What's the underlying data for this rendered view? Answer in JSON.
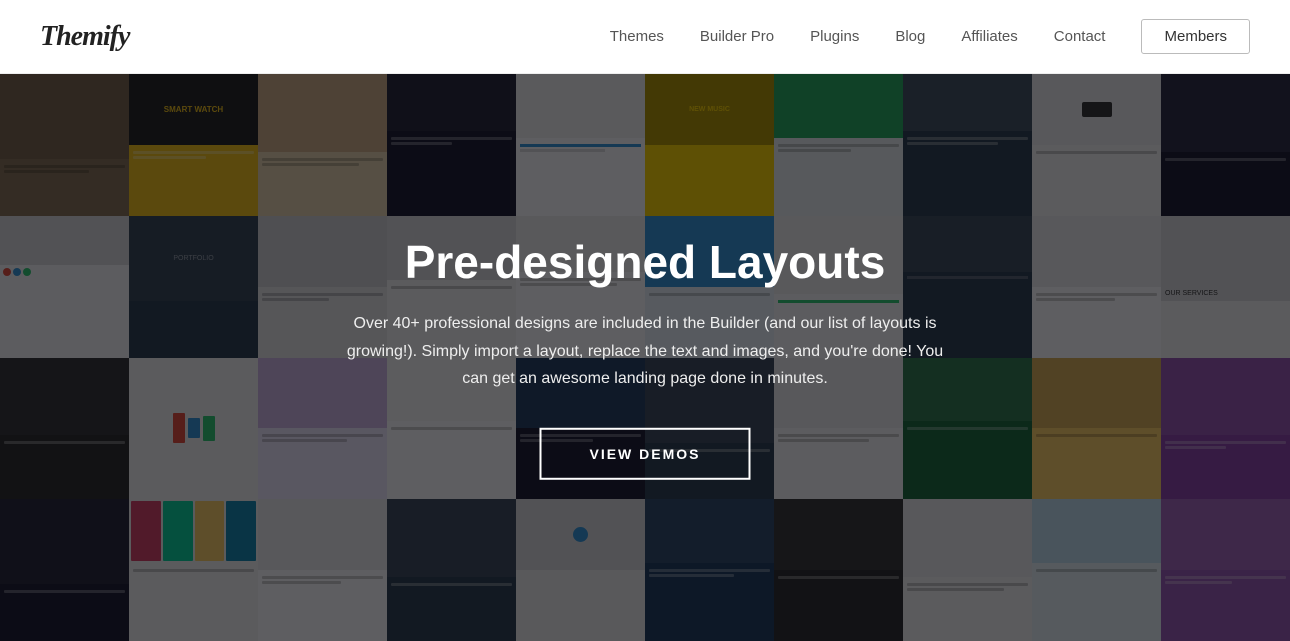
{
  "header": {
    "logo": "Themify",
    "nav": {
      "items": [
        {
          "label": "Themes",
          "id": "themes"
        },
        {
          "label": "Builder Pro",
          "id": "builder-pro"
        },
        {
          "label": "Plugins",
          "id": "plugins"
        },
        {
          "label": "Blog",
          "id": "blog"
        },
        {
          "label": "Affiliates",
          "id": "affiliates"
        },
        {
          "label": "Contact",
          "id": "contact"
        }
      ],
      "cta": "Members"
    }
  },
  "hero": {
    "title": "Pre-designed Layouts",
    "subtitle": "Over 40+ professional designs are included in the Builder (and our list of layouts is growing!). Simply import a layout, replace the text and images, and you're done! You can get an awesome landing page done in minutes.",
    "cta_label": "VIEW DEMOS"
  }
}
